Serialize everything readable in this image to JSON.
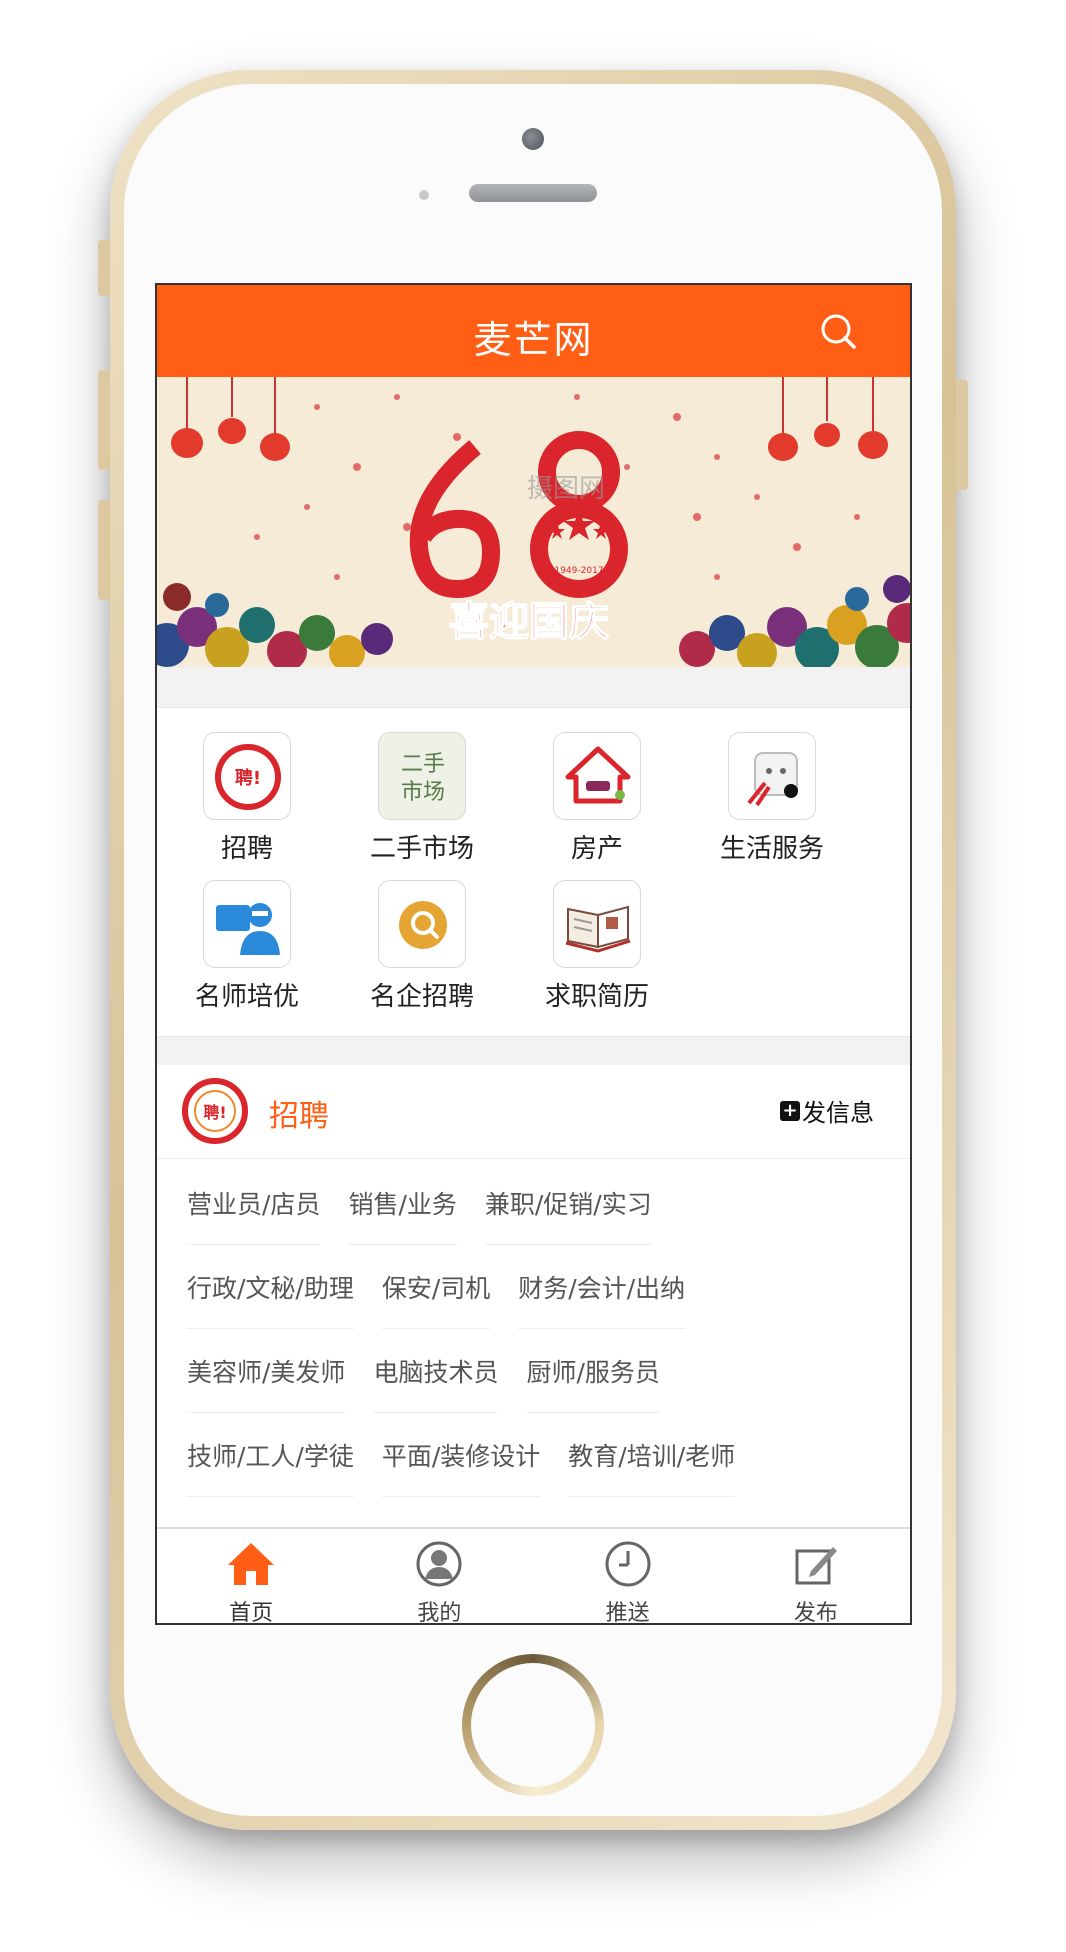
{
  "header": {
    "title": "麦芒网"
  },
  "banner": {
    "number": "68",
    "caption": "喜迎国庆",
    "watermark": "摄图网",
    "years": "1949-2017"
  },
  "categories": [
    {
      "label": "招聘",
      "icon": "recruit-icon"
    },
    {
      "label": "二手市场",
      "icon": "second-hand-icon",
      "glyph_top": "二手",
      "glyph_bottom": "市场"
    },
    {
      "label": "房产",
      "icon": "house-icon"
    },
    {
      "label": "生活服务",
      "icon": "life-service-icon"
    },
    {
      "label": "名师培优",
      "icon": "teacher-icon"
    },
    {
      "label": "名企招聘",
      "icon": "company-recruit-icon"
    },
    {
      "label": "求职简历",
      "icon": "resume-icon"
    }
  ],
  "jobs": {
    "title": "招聘",
    "post_label": "发信息",
    "logo_text": "聘!",
    "rows": [
      [
        "营业员/店员",
        "销售/业务",
        "兼职/促销/实习"
      ],
      [
        "行政/文秘/助理",
        "保安/司机",
        "财务/会计/出纳"
      ],
      [
        "美容师/美发师",
        "电脑技术员",
        "厨师/服务员"
      ],
      [
        "技师/工人/学徒",
        "平面/装修设计",
        "教育/培训/老师"
      ]
    ]
  },
  "tabs": [
    {
      "label": "首页",
      "icon": "home-icon",
      "active": true
    },
    {
      "label": "我的",
      "icon": "user-icon"
    },
    {
      "label": "推送",
      "icon": "clock-icon"
    },
    {
      "label": "发布",
      "icon": "edit-icon"
    }
  ],
  "colors": {
    "brand": "#ff5e14",
    "banner_bg": "#f5ebd6",
    "festive_red": "#d9252b"
  }
}
